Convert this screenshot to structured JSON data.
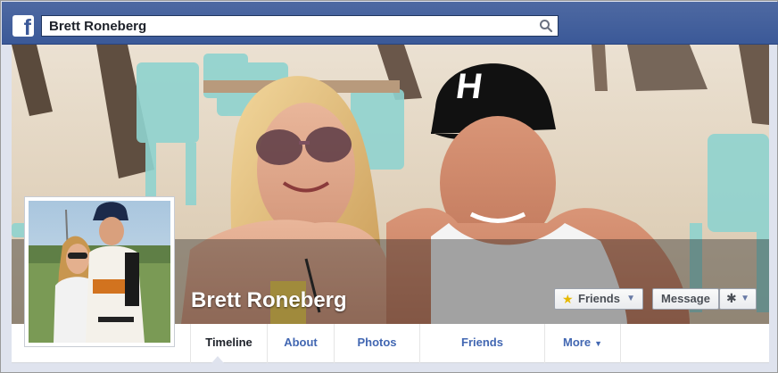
{
  "header": {
    "logo_icon": "facebook-f-icon",
    "search_value": "Brett Roneberg",
    "search_icon": "search-icon",
    "colors": {
      "bar": "#3b5998",
      "bar_border": "#29447e"
    }
  },
  "profile": {
    "name": "Brett Roneberg",
    "cover_photo": "beach cafe couple photo",
    "profile_photo": "couple at baseball field photo"
  },
  "actions": {
    "friends_label": "Friends",
    "friends_icon": "star-icon",
    "message_label": "Message",
    "settings_icon": "gear-icon",
    "caret_icon": "chevron-down-icon"
  },
  "tabs": [
    {
      "label": "Timeline",
      "active": true
    },
    {
      "label": "About",
      "active": false
    },
    {
      "label": "Photos",
      "active": false
    },
    {
      "label": "Friends",
      "active": false
    },
    {
      "label": "More",
      "active": false
    }
  ]
}
